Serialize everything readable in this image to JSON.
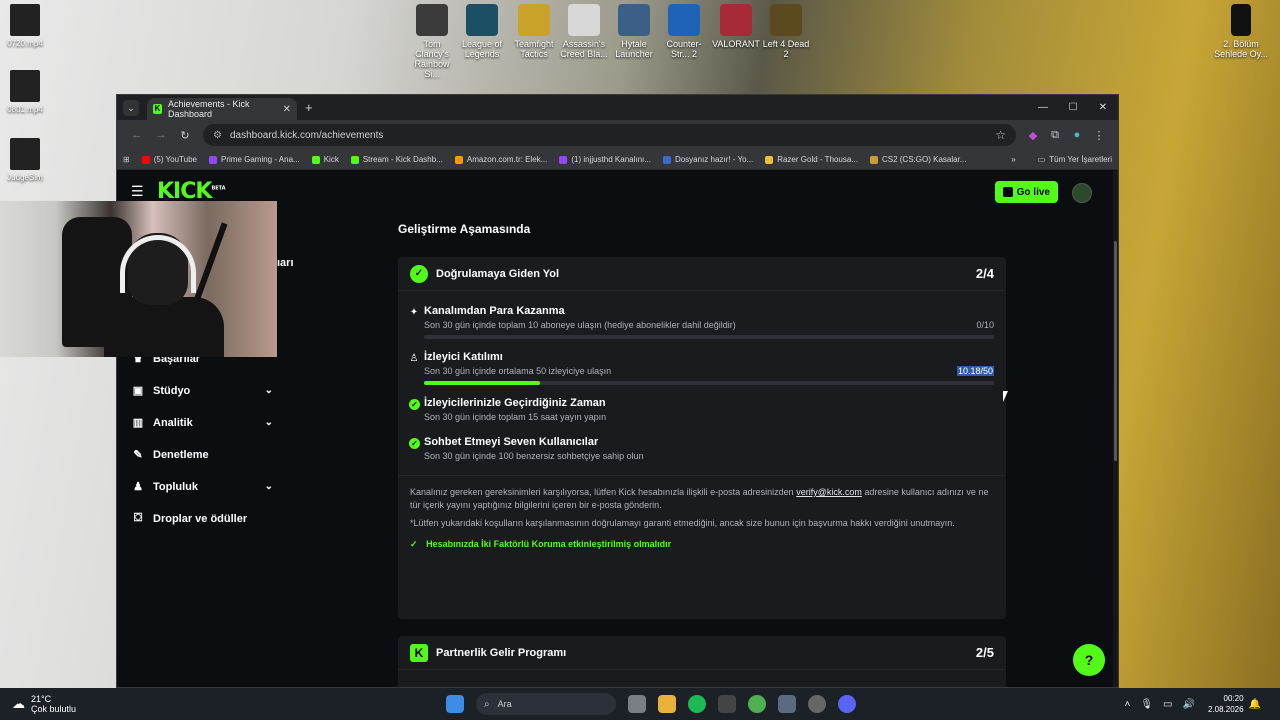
{
  "desktop": {
    "top_icons": [
      {
        "label": "Tom Clancy's Rainbow Si...",
        "color": "#3b3b3b"
      },
      {
        "label": "League of Legends",
        "color": "#1a4f64"
      },
      {
        "label": "Teamfight Tactics",
        "color": "#c9a22a"
      },
      {
        "label": "Assassin's Creed Bla...",
        "color": "#d8d8d8"
      },
      {
        "label": "Hytale Launcher",
        "color": "#3b5f86"
      },
      {
        "label": "Counter-Str... 2",
        "color": "#1e63b8"
      },
      {
        "label": "VALORANT",
        "color": "#a82a38"
      },
      {
        "label": "Left 4 Dead 2",
        "color": "#5a4a1e"
      }
    ],
    "left_icons": [
      "0720.mp4",
      "0801.mp4",
      "JudgeSim"
    ],
    "right_icon": "2. Bölüm Sehlede Oy..."
  },
  "browser": {
    "tab_title": "Achievements - Kick Dashboard",
    "url": "dashboard.kick.com/achievements",
    "bookmarks": [
      {
        "label": "(5) YouTube",
        "color": "#ff0000"
      },
      {
        "label": "Prime Gaming - Ana...",
        "color": "#9146ff"
      },
      {
        "label": "Kick",
        "color": "#53fc18"
      },
      {
        "label": "Stream - Kick Dashb...",
        "color": "#53fc18"
      },
      {
        "label": "Amazon.com.tr: Elek...",
        "color": "#ff9900"
      },
      {
        "label": "(1) injjusthd Kanalını...",
        "color": "#9146ff"
      },
      {
        "label": "Dosyanız hazır! - Yo...",
        "color": "#3a6ccf"
      },
      {
        "label": "Razer Gold - Thousa...",
        "color": "#e8c13a"
      },
      {
        "label": "CS2 (CS:GO) Kasalar...",
        "color": "#c8a030"
      }
    ],
    "bookmarks_more": "»",
    "all_bookmarks": "Tüm Yer İşaretleri"
  },
  "kick": {
    "logo": "KICK",
    "logo_beta": "BETA",
    "go_live": "Go live",
    "sidebar_partial_text": "ıarı",
    "sidebar": [
      {
        "label": "Başarılar",
        "icon": "trophy-icon",
        "chevron": false
      },
      {
        "label": "Stüdyo",
        "icon": "monitor-icon",
        "chevron": true
      },
      {
        "label": "Analitik",
        "icon": "chart-icon",
        "chevron": true
      },
      {
        "label": "Denetleme",
        "icon": "wrench-icon",
        "chevron": false
      },
      {
        "label": "Topluluk",
        "icon": "users-icon",
        "chevron": true
      },
      {
        "label": "Droplar ve ödüller",
        "icon": "gift-icon",
        "chevron": false
      }
    ],
    "section_title": "Geliştirme Aşamasında",
    "verification_card": {
      "title": "Doğrulamaya Giden Yol",
      "count": "2/4",
      "requirements": [
        {
          "title": "Kanalımdan Para Kazanma",
          "desc": "Son 30 gün içinde toplam 10 aboneye ulaşın (hediye abonelikler dahil değildir)",
          "value": "0/10",
          "progress": 0,
          "done": false,
          "icon": "sparkle-icon"
        },
        {
          "title": "İzleyici Katılımı",
          "desc": "Son 30 gün içinde ortalama 50 izleyiciye ulaşın",
          "value": "10.18/50",
          "progress": 0.2036,
          "done": false,
          "icon": "viewers-icon"
        },
        {
          "title": "İzleyicilerinizle Geçirdiğiniz Zaman",
          "desc": "Son 30 gün içinde toplam 15 saat yayın yapın",
          "done": true
        },
        {
          "title": "Sohbet Etmeyi Seven Kullanıcılar",
          "desc": "Son 30 gün içinde 100 benzersiz sohbetçiye sahip olun",
          "done": true
        }
      ],
      "info_before": "Kanalınız gereken gereksinimleri karşılıyorsa, lütfen Kick hesabınızla ilişkili e-posta adresinizden",
      "info_email": "verify@kick.com",
      "info_after": "adresine kullanıcı adınızı ve ne tür içerik yayını yaptığınız bilgilerini içeren bir e-posta gönderin.",
      "disclaimer": "*Lütfen yukarıdaki koşulların karşılanmasının doğrulamayı garanti etmediğini, ancak size bunun için başvurma hakkı verdiğini unutmayın.",
      "twofa": "Hesabınızda İki Faktörlü Koruma etkinleştirilmiş olmalıdır"
    },
    "partner_card": {
      "title": "Partnerlik Gelir Programı",
      "count": "2/5"
    }
  },
  "taskbar": {
    "temp": "21°C",
    "weather": "Çok bulutlu",
    "search": "Ara",
    "time": "00:20",
    "date": "2.08.2026"
  }
}
